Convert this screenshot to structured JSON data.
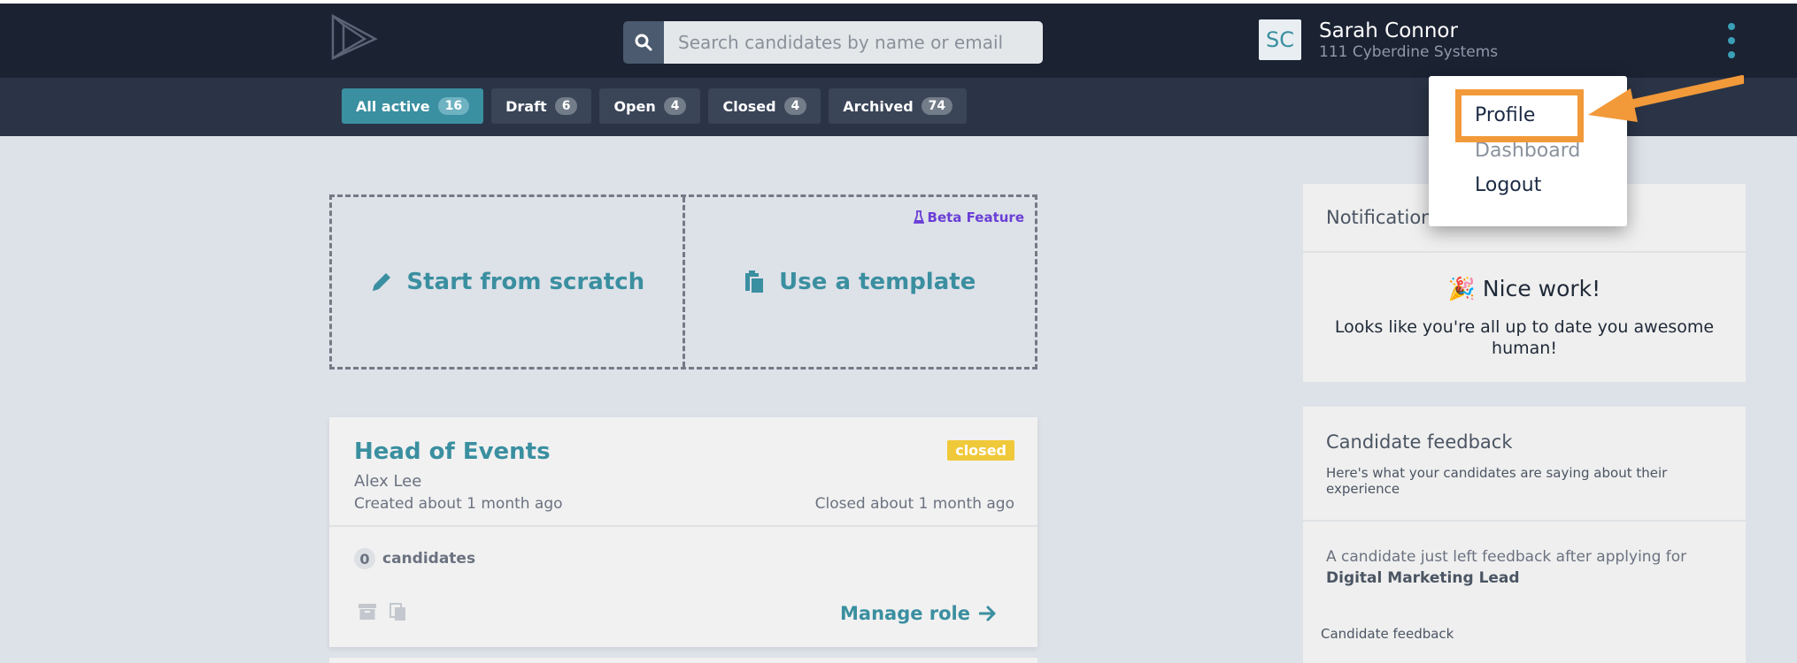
{
  "header": {
    "search_placeholder": "Search candidates by name or email",
    "user": {
      "initials": "SC",
      "name": "Sarah Connor",
      "company": "111 Cyberdine Systems"
    }
  },
  "tabs": [
    {
      "label": "All active",
      "count": "16",
      "active": true
    },
    {
      "label": "Draft",
      "count": "6",
      "active": false
    },
    {
      "label": "Open",
      "count": "4",
      "active": false
    },
    {
      "label": "Closed",
      "count": "4",
      "active": false
    },
    {
      "label": "Archived",
      "count": "74",
      "active": false
    }
  ],
  "create": {
    "scratch_label": "Start from scratch",
    "template_label": "Use a template",
    "beta_label": "Beta Feature"
  },
  "role_card": {
    "title": "Head of Events",
    "status": "closed",
    "owner": "Alex Lee",
    "created": "Created about 1 month ago",
    "closed": "Closed about 1 month ago",
    "candidate_count": "0",
    "candidates_label": "candidates",
    "manage_label": "Manage role"
  },
  "notifications": {
    "title": "Notifications",
    "heading": "Nice work!",
    "emoji": "🎉",
    "message": "Looks like you're all up to date you awesome human!"
  },
  "feedback": {
    "title": "Candidate feedback",
    "subtitle": "Here's what your candidates are saying about their experience",
    "item_text": "A candidate just left feedback after applying for",
    "item_role": "Digital Marketing Lead",
    "footer": "Candidate feedback"
  },
  "dropdown": {
    "items": [
      "Profile",
      "Dashboard",
      "Logout"
    ]
  },
  "colors": {
    "accent": "#3a8fa0",
    "topbar": "#1b2232",
    "highlight": "#f2993a",
    "closed_badge": "#f0c93a"
  }
}
